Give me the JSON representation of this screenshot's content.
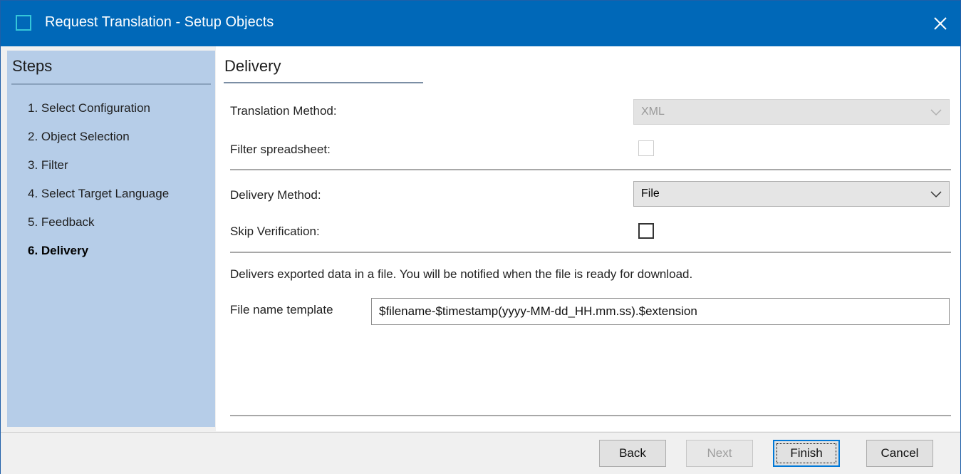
{
  "window": {
    "title": "Request Translation - Setup Objects"
  },
  "steps": {
    "heading": "Steps",
    "items": [
      {
        "label": "1. Select Configuration",
        "active": false
      },
      {
        "label": "2. Object Selection",
        "active": false
      },
      {
        "label": "3. Filter",
        "active": false
      },
      {
        "label": "4. Select Target Language",
        "active": false
      },
      {
        "label": "5. Feedback",
        "active": false
      },
      {
        "label": "6. Delivery",
        "active": true
      }
    ]
  },
  "delivery": {
    "title": "Delivery",
    "translation_method_label": "Translation Method:",
    "translation_method_value": "XML",
    "filter_spreadsheet_label": "Filter spreadsheet:",
    "delivery_method_label": "Delivery Method:",
    "delivery_method_value": "File",
    "skip_verification_label": "Skip Verification:",
    "info_text": "Delivers exported data in a file. You will be notified when the file is ready for download.",
    "file_name_template_label": "File name template",
    "file_name_template_value": "$filename-$timestamp(yyyy-MM-dd_HH.mm.ss).$extension"
  },
  "buttons": {
    "back": "Back",
    "next": "Next",
    "finish": "Finish",
    "cancel": "Cancel"
  },
  "colors": {
    "titlebar": "#0068b8",
    "steps_panel": "#b6cde8",
    "default_button_border": "#0078d7"
  }
}
